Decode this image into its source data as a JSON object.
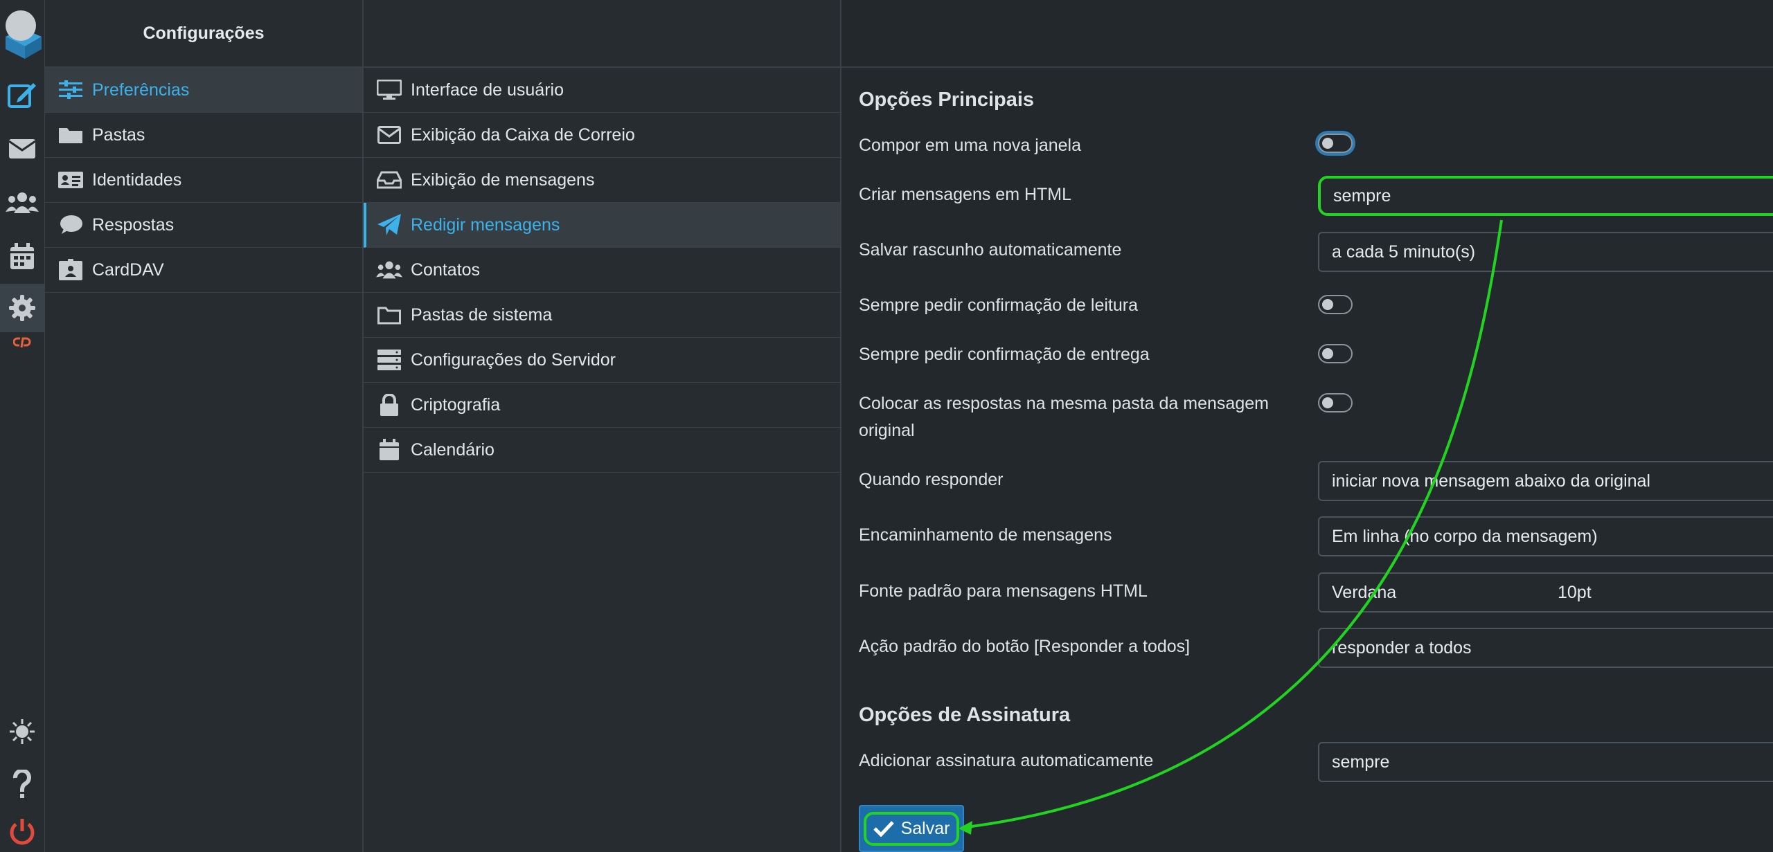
{
  "settings": {
    "title": "Configurações",
    "items": [
      {
        "label": "Preferências",
        "icon": "sliders-icon"
      },
      {
        "label": "Pastas",
        "icon": "folder-icon"
      },
      {
        "label": "Identidades",
        "icon": "id-card-icon"
      },
      {
        "label": "Respostas",
        "icon": "comment-icon"
      },
      {
        "label": "CardDAV",
        "icon": "address-book-icon"
      }
    ]
  },
  "sections": {
    "items": [
      {
        "label": "Interface de usuário",
        "icon": "monitor-icon"
      },
      {
        "label": "Exibição da Caixa de Correio",
        "icon": "envelope-icon"
      },
      {
        "label": "Exibição de mensagens",
        "icon": "inbox-icon"
      },
      {
        "label": "Redigir mensagens",
        "icon": "paper-plane-icon"
      },
      {
        "label": "Contatos",
        "icon": "users-icon"
      },
      {
        "label": "Pastas de sistema",
        "icon": "folder-outline-icon"
      },
      {
        "label": "Configurações do Servidor",
        "icon": "server-icon"
      },
      {
        "label": "Criptografia",
        "icon": "lock-icon"
      },
      {
        "label": "Calendário",
        "icon": "calendar-icon"
      }
    ]
  },
  "main": {
    "section1_title": "Opções Principais",
    "compose_new_window": "Compor em uma nova janela",
    "create_html": "Criar mensagens em HTML",
    "create_html_value": "sempre",
    "autosave": "Salvar rascunho automaticamente",
    "autosave_value": "a cada 5 minuto(s)",
    "read_receipt": "Sempre pedir confirmação de leitura",
    "delivery_receipt": "Sempre pedir confirmação de entrega",
    "replies_same_folder_1": "Colocar as respostas na mesma pasta da mensagem",
    "replies_same_folder_2": "original",
    "when_reply": "Quando responder",
    "when_reply_value": "iniciar nova mensagem abaixo da original",
    "forwarding": "Encaminhamento de mensagens",
    "forwarding_value": "Em linha (no corpo da mensagem)",
    "default_font": "Fonte padrão para mensagens HTML",
    "font_value": "Verdana",
    "font_size_value": "10pt",
    "reply_all_action": "Ação padrão do botão [Responder a todos]",
    "reply_all_value": "responder a todos",
    "section2_title": "Opções de Assinatura",
    "auto_signature": "Adicionar assinatura automaticamente",
    "auto_signature_value": "sempre",
    "save_label": "Salvar"
  },
  "toggles": {
    "compose_new_window": false,
    "read_receipt": false,
    "delivery_receipt": false,
    "replies_same_folder": false
  },
  "colors": {
    "accent": "#3cb1ea",
    "annotation": "#22d322",
    "save_button": "#1c6da9",
    "logout_icon": "#e24b3b"
  }
}
